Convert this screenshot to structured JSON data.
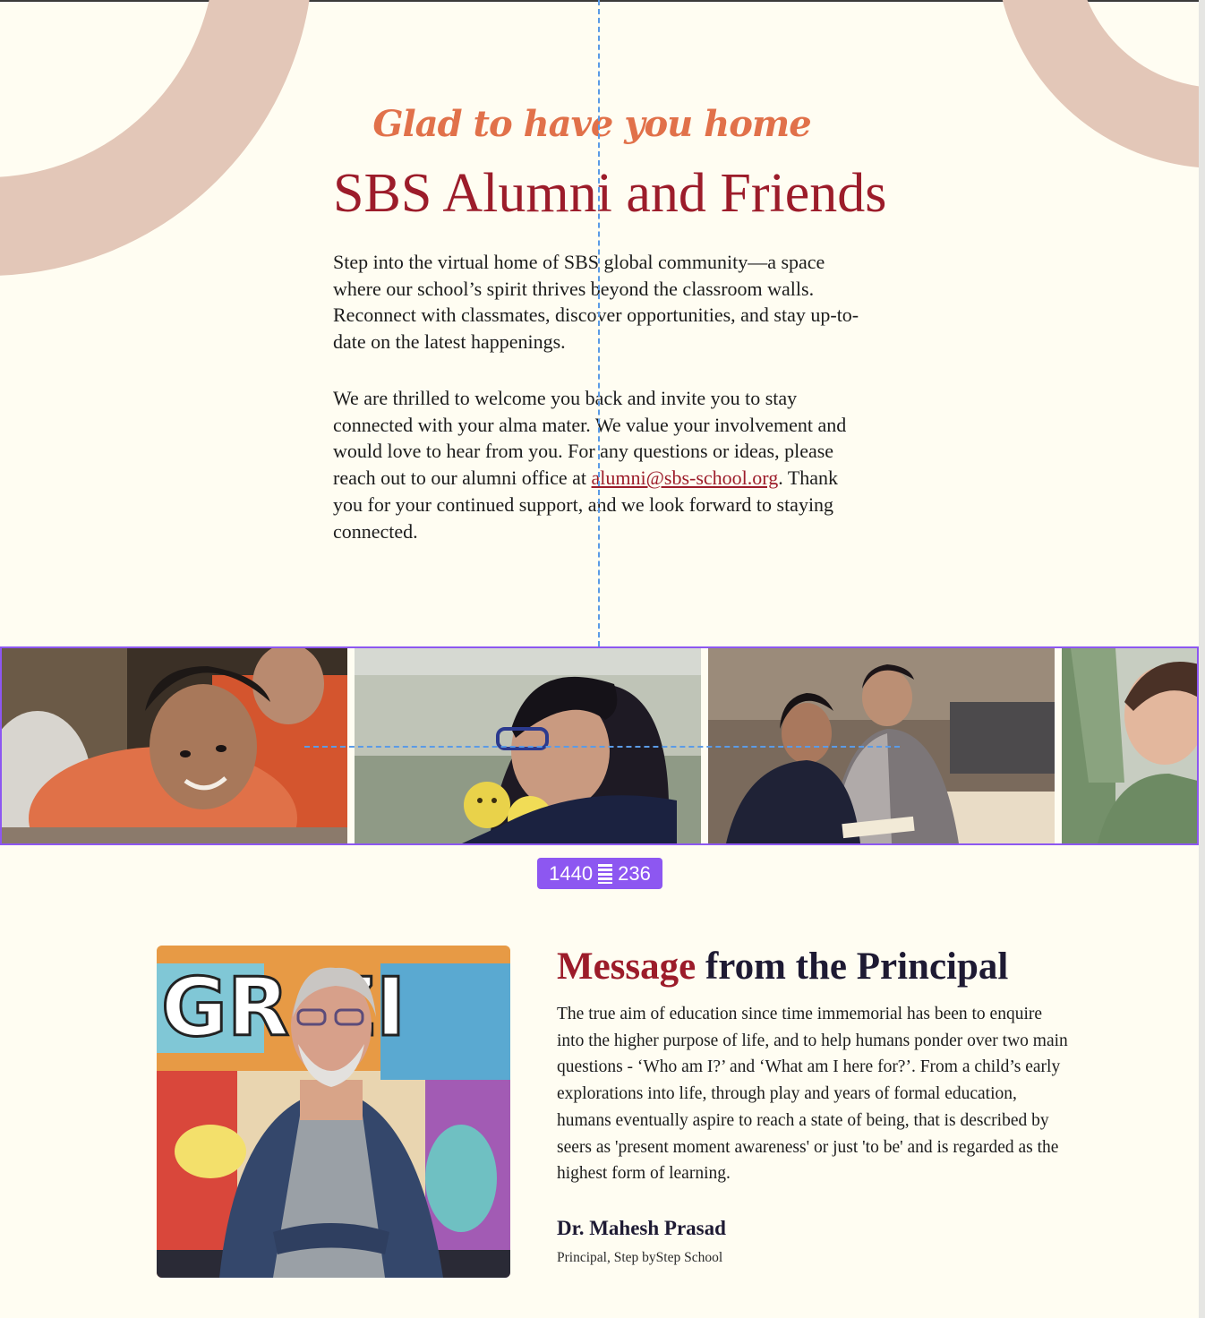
{
  "hero": {
    "tagline": "Glad to have you home",
    "title": "SBS Alumni and Friends",
    "paragraph1": "Step into the virtual home of SBS global community—a space where our school’s spirit thrives beyond the classroom walls. Reconnect with classmates, discover opportunities, and stay up-to-date on the latest happenings.",
    "paragraph2_before_link": "We are thrilled to welcome you back and invite you to stay connected with your alma mater. We value your involvement and would love to hear from you. For any questions or ideas, please reach out to our alumni office at ",
    "email_link": "alumni@sbs-school.org",
    "paragraph2_after_link": ". Thank you for your continued support, and we look forward to staying connected."
  },
  "gallery": {
    "size_badge": {
      "width": "1440",
      "height": "236"
    },
    "photos": [
      {
        "name": "smiling-boy-photo"
      },
      {
        "name": "girl-with-smiley-balls-photo"
      },
      {
        "name": "teacher-and-student-reading-photo"
      },
      {
        "name": "child-raising-hand-photo"
      }
    ]
  },
  "principal": {
    "title_accent": "Message",
    "title_rest": " from the Principal",
    "message": "The true aim of education since time immemorial has been to enquire into the higher purpose of life, and to help humans ponder over two main questions - ‘Who am I?’ and ‘What am I here for?’. From a child’s early explorations into life, through play and years of formal education, humans eventually aspire to reach a state of being, that is described by seers as 'present moment awareness' or just 'to be' and is regarded as the highest form of learning.",
    "name": "Dr. Mahesh Prasad",
    "role": "Principal, Step byStep School"
  },
  "colors": {
    "background": "#fffdf2",
    "arc": "#e3c7b8",
    "maroon": "#9c1c2a",
    "tagline": "#e1714a",
    "selection": "#8d57f1",
    "guide": "#5b9be6"
  }
}
